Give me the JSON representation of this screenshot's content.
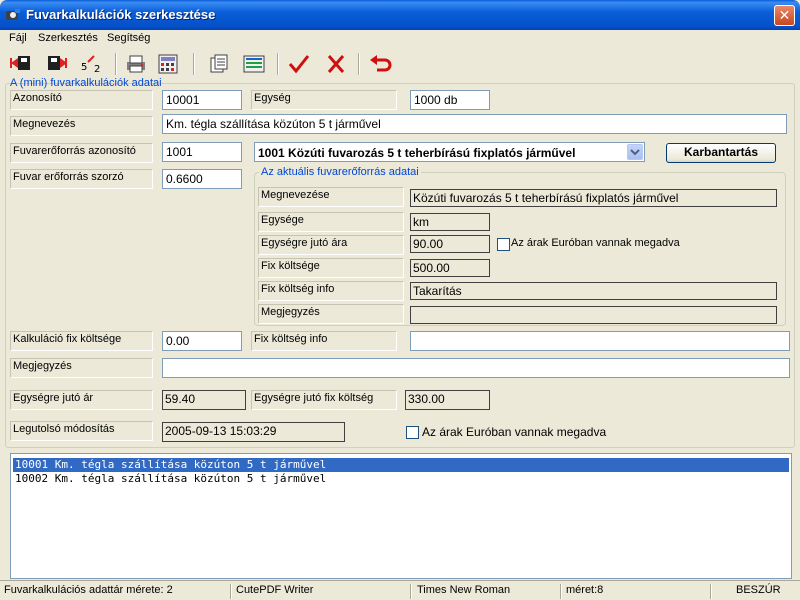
{
  "window": {
    "title": "Fuvarkalkulációk szerkesztése"
  },
  "menu": {
    "items": [
      "Fájl",
      "Szerkesztés",
      "Segítség"
    ]
  },
  "toolbar": {
    "buttons": [
      "first-record",
      "last-record",
      "goto-record",
      "print",
      "calculator",
      "copy",
      "list-view",
      "accept",
      "cancel",
      "undo"
    ]
  },
  "section_title": "A (mini) fuvarkalkulációk adatai",
  "form": {
    "azonosito": {
      "label": "Azonosító",
      "value": "10001"
    },
    "egyseg": {
      "label": "Egység",
      "value": "1000 db"
    },
    "megnevezes": {
      "label": "Megnevezés",
      "value": "Km. tégla szállítása közúton 5 t járművel"
    },
    "fuvareroforras_azonosito": {
      "label": "Fuvarerőforrás azonosító",
      "value": "1001"
    },
    "fuvareroforras_combo": "1001 Közúti fuvarozás 5 t teherbírású fixplatós járművel",
    "karbantartas_button": "Karbantartás",
    "szorzo": {
      "label": "Fuvar erőforrás szorzó",
      "value": "0.6600"
    },
    "fix_koltseg": {
      "label": "Kalkuláció fix költsége",
      "value": "0.00"
    },
    "fix_koltseg_info": {
      "label": "Fix költség info",
      "value": ""
    },
    "megjegyzes": {
      "label": "Megjegyzés",
      "value": ""
    },
    "egysegre_juto_ar": {
      "label": "Egységre jutó ár",
      "value": "59.40"
    },
    "egysegre_juto_fix": {
      "label": "Egységre jutó fix költség",
      "value": "330.00"
    },
    "legutolso": {
      "label": "Legutolsó módosítás",
      "value": "2005-09-13 15:03:29"
    },
    "euro_checkbox_main": "Az árak Euróban vannak megadva"
  },
  "group": {
    "title": "Az aktuális fuvarerőforrás adatai",
    "megnevezese": {
      "label": "Megnevezése",
      "value": "Közúti fuvarozás 5 t teherbírású fixplatós járművel"
    },
    "egysege": {
      "label": "Egysége",
      "value": "km"
    },
    "egysegre_juto_ara": {
      "label": "Egységre jutó ára",
      "value": "90.00"
    },
    "euro_checkbox": "Az árak Euróban vannak megadva",
    "fix_koltsege": {
      "label": "Fix költsége",
      "value": "500.00"
    },
    "fix_koltseg_info": {
      "label": "Fix költség info",
      "value": "Takarítás"
    },
    "megjegyzes": {
      "label": "Megjegyzés",
      "value": ""
    }
  },
  "list": {
    "rows": [
      "10001 Km. tégla szállítása közúton 5 t járművel",
      "10002 Km. tégla szállítása közúton 5 t járművel"
    ],
    "selected_index": 0
  },
  "statusbar": {
    "cells": [
      "Fuvarkalkulációs adattár mérete: 2",
      "CutePDF Writer",
      "Times New Roman",
      "méret:8",
      "BESZÚR"
    ]
  },
  "colors": {
    "titlebar": "#0a5fd8",
    "selection": "#316ac5",
    "group_title": "#0046d5"
  }
}
